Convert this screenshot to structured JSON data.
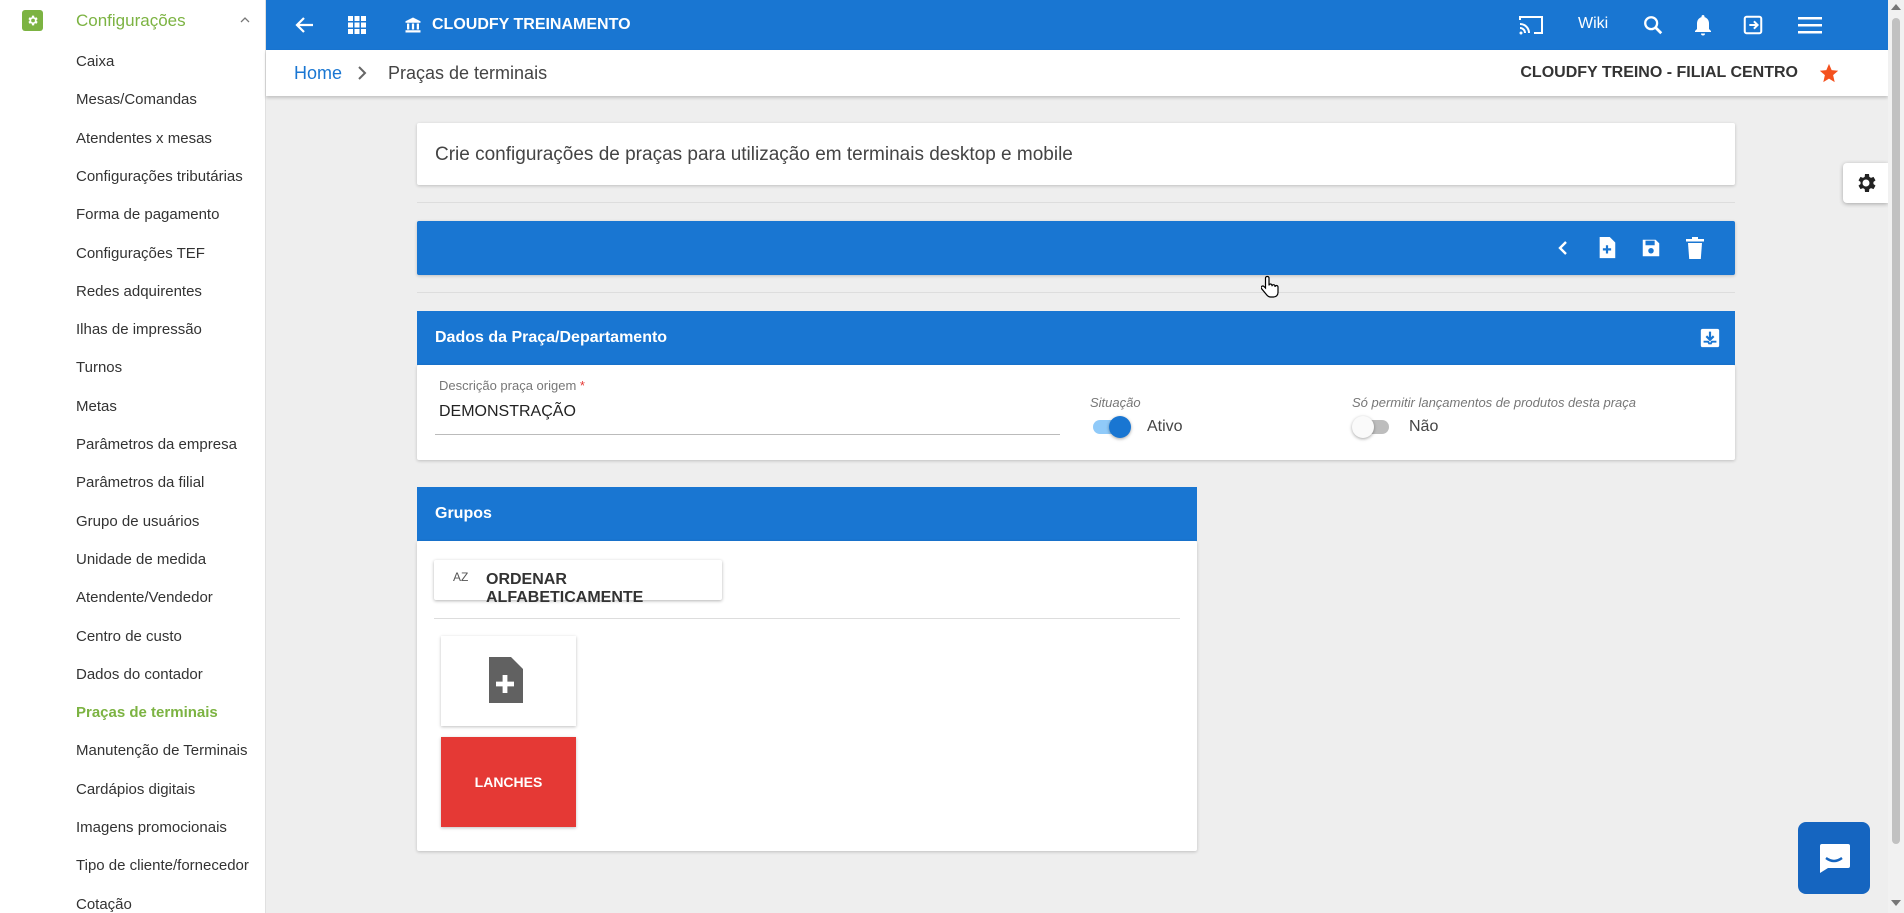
{
  "sidebar": {
    "title": "Configurações",
    "items": [
      {
        "label": "Caixa"
      },
      {
        "label": "Mesas/Comandas"
      },
      {
        "label": "Atendentes x mesas"
      },
      {
        "label": "Configurações tributárias"
      },
      {
        "label": "Forma de pagamento"
      },
      {
        "label": "Configurações TEF"
      },
      {
        "label": "Redes adquirentes"
      },
      {
        "label": "Ilhas de impressão"
      },
      {
        "label": "Turnos"
      },
      {
        "label": "Metas"
      },
      {
        "label": "Parâmetros da empresa"
      },
      {
        "label": "Parâmetros da filial"
      },
      {
        "label": "Grupo de usuários"
      },
      {
        "label": "Unidade de medida"
      },
      {
        "label": "Atendente/Vendedor"
      },
      {
        "label": "Centro de custo"
      },
      {
        "label": "Dados do contador"
      },
      {
        "label": "Praças de terminais",
        "active": true
      },
      {
        "label": "Manutenção de Terminais"
      },
      {
        "label": "Cardápios digitais"
      },
      {
        "label": "Imagens promocionais"
      },
      {
        "label": "Tipo de cliente/fornecedor"
      },
      {
        "label": "Cotação"
      }
    ]
  },
  "topbar": {
    "title": "CLOUDFY TREINAMENTO",
    "wiki": "Wiki",
    "icons": [
      "back-arrow-icon",
      "apps-grid-icon",
      "bank-icon",
      "cast-icon",
      "search-icon",
      "bell-icon",
      "logout-icon",
      "menu-icon"
    ]
  },
  "breadcrumb": {
    "home": "Home",
    "current": "Praças de terminais",
    "branch": "CLOUDFY TREINO - FILIAL CENTRO"
  },
  "main": {
    "info_text": "Crie configurações de praças para utilização em terminais desktop e mobile",
    "section_dados": {
      "title": "Dados da Praça/Departamento",
      "descricao_label": "Descrição praça origem",
      "descricao_required": "*",
      "descricao_value": "DEMONSTRAÇÃO",
      "situacao_label": "Situação",
      "situacao_value": "Ativo",
      "situacao_on": true,
      "restricao_label": "Só permitir lançamentos de produtos desta praça",
      "restricao_value": "Não",
      "restricao_on": false
    },
    "section_grupos": {
      "title": "Grupos",
      "order_button": "ORDENAR ALFABETICAMENTE",
      "order_icon_text": "AZ",
      "tiles": [
        {
          "label": "LANCHES",
          "color": "#e53935"
        }
      ]
    }
  },
  "colors": {
    "primary": "#1976d2",
    "accent_green": "#7cb342",
    "star": "#f4511e",
    "tile_red": "#e53935"
  }
}
